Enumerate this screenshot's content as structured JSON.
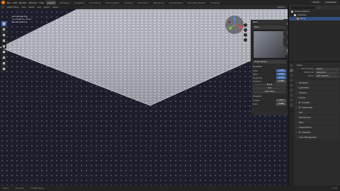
{
  "topbar": {
    "menus": [
      "File",
      "Edit",
      "Render",
      "Window",
      "Help"
    ],
    "workspaces": [
      "Layout",
      "Modeling",
      "Sculpting",
      "UV Editing",
      "Texture Paint",
      "Shading",
      "Animation",
      "Rendering",
      "Compositing",
      "Geometry Nodes",
      "Scripting"
    ],
    "active_workspace": "Layout",
    "scene": "Scene",
    "view_layer": "ViewLayer"
  },
  "viewport": {
    "header_items": [
      "Object Mode",
      "View",
      "Select",
      "Add",
      "Object"
    ],
    "orientation": "Global",
    "info_lines": [
      "User Perspective",
      "(1) Collection | Plane",
      "Rendering Done"
    ],
    "options_label": "Options"
  },
  "node_panel": {
    "title": "Node",
    "header": "Image Texture",
    "image_name": "Wave",
    "params_title": "Properties",
    "rows": [
      {
        "label": "Scale",
        "value": "1.000"
      },
      {
        "label": "Detail",
        "value": "2.000"
      },
      {
        "label": "Roughness",
        "value": "0.500"
      },
      {
        "label": "Distortion",
        "value": "0.000"
      }
    ],
    "mode_label": "Bands",
    "profile_label": "Sine",
    "button_label": "Open Node",
    "transform_title": "Transform",
    "transform_rows": [
      {
        "label": "Location",
        "value": "0 m"
      },
      {
        "label": "Scale",
        "value": "1.000"
      }
    ]
  },
  "sidetabs": [
    "Item",
    "Tool",
    "View",
    "Node"
  ],
  "outliner": {
    "items": [
      {
        "label": "Scene Collection",
        "color": "#cfcfcf",
        "selected": false
      },
      {
        "label": "Collection",
        "color": "#e0e0e0",
        "selected": false
      },
      {
        "label": "Plane",
        "color": "#e88c2a",
        "selected": true
      }
    ]
  },
  "properties": {
    "breadcrumb": "Scene",
    "rows": [
      {
        "label": "Render Engine",
        "value": "Cycles"
      },
      {
        "label": "Feature Set",
        "value": "Supported"
      },
      {
        "label": "Device",
        "value": "GPU Compute"
      }
    ],
    "panels": [
      "Sampling",
      "Light Paths",
      "Volumes",
      "Curves",
      "Simplify",
      "Motion Blur",
      "Film",
      "Performance",
      "Bake",
      "Grease Pencil",
      "Freestyle",
      "Color Management"
    ]
  },
  "statusbar": {
    "left": "Select",
    "middle": "Pan View",
    "right": "Context Menu",
    "version": "3.6.0"
  }
}
